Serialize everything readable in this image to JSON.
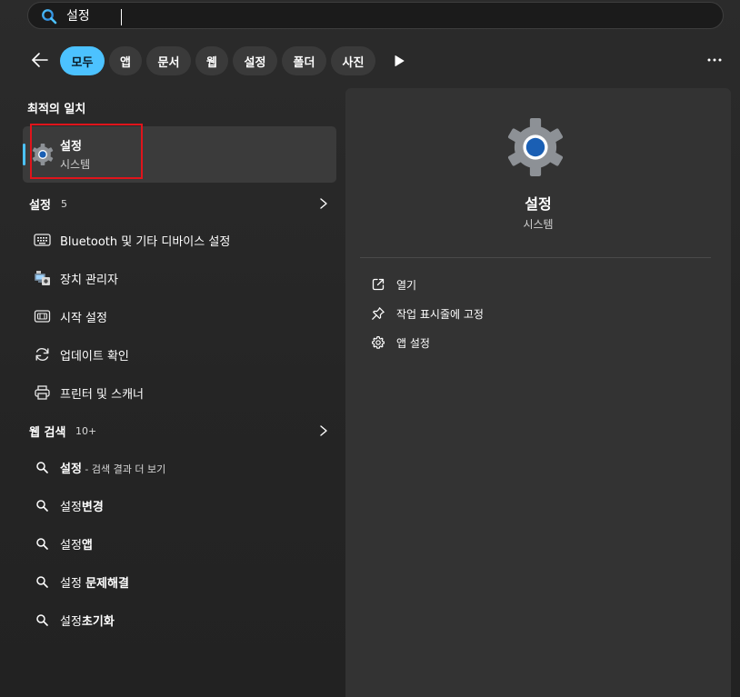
{
  "search": {
    "value": "설정",
    "icon": "search-icon"
  },
  "filters": {
    "back_icon": "back-arrow-icon",
    "tabs": [
      "모두",
      "앱",
      "문서",
      "웹",
      "설정",
      "폴더",
      "사진"
    ],
    "active": "모두",
    "play_icon": "play-icon",
    "more_icon": "more-icon"
  },
  "best_match": {
    "section_title": "최적의 일치",
    "title": "설정",
    "subtitle": "시스템",
    "icon": "settings-gear-icon"
  },
  "settings_group": {
    "title": "설정",
    "count": "5",
    "items": [
      {
        "label": "Bluetooth 및 기타 디바이스 설정",
        "icon": "keyboard-icon"
      },
      {
        "label": "장치 관리자",
        "icon": "device-manager-icon"
      },
      {
        "label": "시작 설정",
        "icon": "start-icon"
      },
      {
        "label": "업데이트 확인",
        "icon": "update-icon"
      },
      {
        "label": "프린터 및 스캐너",
        "icon": "printer-icon"
      }
    ]
  },
  "web_search": {
    "title": "웹 검색",
    "count": "10+",
    "items": [
      {
        "prefix": "설정",
        "bold": "",
        "suffix": " - 검색 결과 더 보기"
      },
      {
        "prefix": "설정",
        "bold": "변경",
        "suffix": ""
      },
      {
        "prefix": "설정",
        "bold": "앱",
        "suffix": ""
      },
      {
        "prefix": "설정 ",
        "bold": "문제해결",
        "suffix": ""
      },
      {
        "prefix": "설정",
        "bold": "초기화",
        "suffix": ""
      }
    ]
  },
  "preview": {
    "title": "설정",
    "subtitle": "시스템",
    "actions": [
      {
        "label": "열기",
        "icon": "open-external-icon"
      },
      {
        "label": "작업 표시줄에 고정",
        "icon": "pin-icon"
      },
      {
        "label": "앱 설정",
        "icon": "gear-icon"
      }
    ]
  },
  "colors": {
    "accent": "#4cc2ff",
    "highlight_box": "#e0141b",
    "background": "#202020"
  }
}
